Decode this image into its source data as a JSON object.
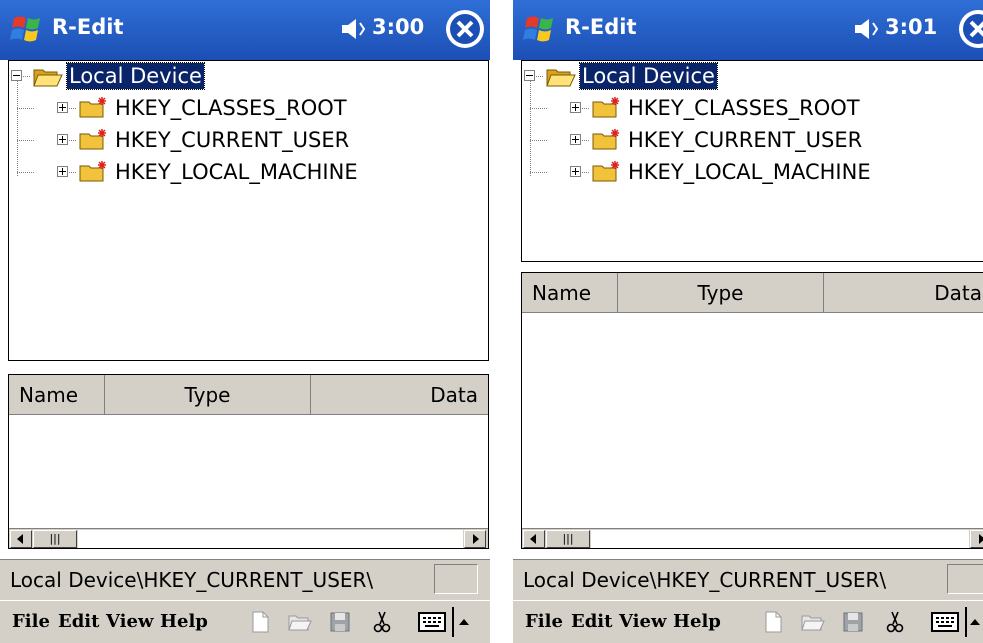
{
  "screens": [
    {
      "title": "R-Edit",
      "time": "3:00",
      "tree": {
        "root": "Local Device",
        "children": [
          "HKEY_CLASSES_ROOT",
          "HKEY_CURRENT_USER",
          "HKEY_LOCAL_MACHINE"
        ]
      },
      "list": {
        "columns": [
          "Name",
          "Type",
          "Data"
        ]
      },
      "status_path": "Local Device\\HKEY_CURRENT_USER\\",
      "menu": [
        "File",
        "Edit",
        "View",
        "Help"
      ]
    },
    {
      "title": "R-Edit",
      "time": "3:01",
      "tree": {
        "root": "Local Device",
        "children": [
          "HKEY_CLASSES_ROOT",
          "HKEY_CURRENT_USER",
          "HKEY_LOCAL_MACHINE"
        ]
      },
      "list": {
        "columns": [
          "Name",
          "Type",
          "Data"
        ]
      },
      "status_path": "Local Device\\HKEY_CURRENT_USER\\",
      "menu": [
        "File",
        "Edit",
        "View",
        "Help"
      ]
    }
  ],
  "icons": {
    "start": "windows-flag-icon",
    "volume": "speaker-icon",
    "close": "close-icon",
    "folder_open": "open-folder-icon",
    "registry_key": "registry-folder-icon",
    "toolbar": [
      "new-document-icon",
      "open-folder-icon",
      "save-icon",
      "cut-icon"
    ],
    "input": "keyboard-icon"
  },
  "colors": {
    "titlebar": "#1c4fb5",
    "selection": "#0a246a",
    "chrome": "#d4d0c8"
  }
}
